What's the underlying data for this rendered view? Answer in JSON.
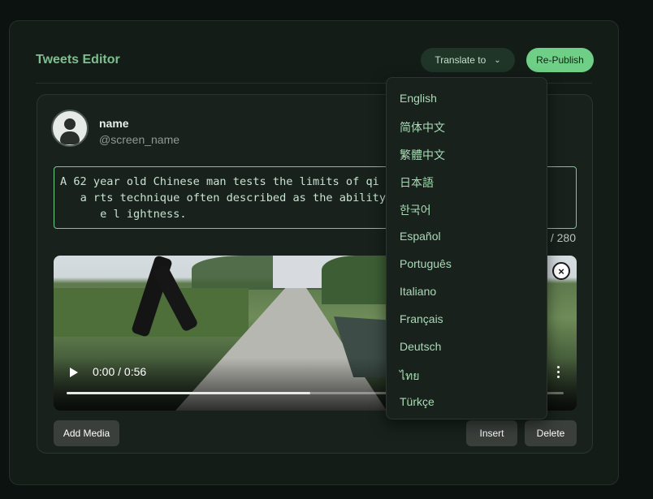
{
  "editor": {
    "title": "Tweets Editor"
  },
  "toolbar": {
    "translate_label": "Translate to",
    "republish_label": "Re-Publish"
  },
  "user": {
    "name": "name",
    "screen_name": "@screen_name"
  },
  "tweet": {
    "text": "A 62 year old Chinese man tests the limits of qi                                   arts technique often described as the ability to                                     lightness.",
    "char_count_visible": "/ 280"
  },
  "video": {
    "time": "0:00 / 0:56",
    "progress_fraction": 0.49
  },
  "buttons": {
    "add_media": "Add Media",
    "insert": "Insert",
    "delete": "Delete"
  },
  "languages": [
    "English",
    "简体中文",
    "繁體中文",
    "日本語",
    "한국어",
    "Español",
    "Português",
    "Italiano",
    "Français",
    "Deutsch",
    "ไทย",
    "Türkçe"
  ],
  "colors": {
    "accent": "#6fcf86",
    "title": "#7fbf8e",
    "background": "#0b120f",
    "panel": "#141c18"
  }
}
